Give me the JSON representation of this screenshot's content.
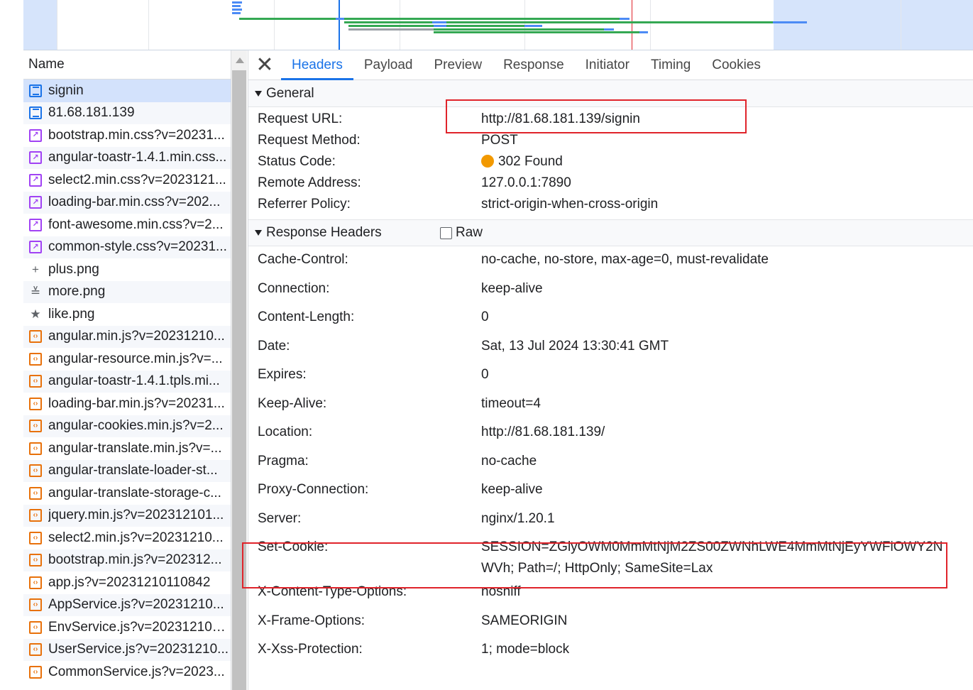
{
  "colors": {
    "accent": "#1a73e8",
    "highlight_box": "#e0242b",
    "status_warning": "#f29900",
    "timeline_green": "#34a853",
    "timeline_blue": "#4c8bf5"
  },
  "request_list": {
    "header": "Name",
    "items": [
      {
        "name": "signin",
        "icon": "document-icon",
        "type": "doc"
      },
      {
        "name": "81.68.181.139",
        "icon": "document-icon",
        "type": "doc"
      },
      {
        "name": "bootstrap.min.css?v=20231...",
        "icon": "stylesheet-icon",
        "type": "css"
      },
      {
        "name": "angular-toastr-1.4.1.min.css...",
        "icon": "stylesheet-icon",
        "type": "css"
      },
      {
        "name": "select2.min.css?v=2023121...",
        "icon": "stylesheet-icon",
        "type": "css"
      },
      {
        "name": "loading-bar.min.css?v=202...",
        "icon": "stylesheet-icon",
        "type": "css"
      },
      {
        "name": "font-awesome.min.css?v=2...",
        "icon": "stylesheet-icon",
        "type": "css"
      },
      {
        "name": "common-style.css?v=20231...",
        "icon": "stylesheet-icon",
        "type": "css"
      },
      {
        "name": "plus.png",
        "icon": "plus-image-icon",
        "type": "img",
        "glyph": "+"
      },
      {
        "name": "more.png",
        "icon": "double-chevron-image-icon",
        "type": "img",
        "glyph": "≚"
      },
      {
        "name": "like.png",
        "icon": "star-image-icon",
        "type": "img",
        "glyph": "★"
      },
      {
        "name": "angular.min.js?v=20231210...",
        "icon": "script-icon",
        "type": "js"
      },
      {
        "name": "angular-resource.min.js?v=...",
        "icon": "script-icon",
        "type": "js"
      },
      {
        "name": "angular-toastr-1.4.1.tpls.mi...",
        "icon": "script-icon",
        "type": "js"
      },
      {
        "name": "loading-bar.min.js?v=20231...",
        "icon": "script-icon",
        "type": "js"
      },
      {
        "name": "angular-cookies.min.js?v=2...",
        "icon": "script-icon",
        "type": "js"
      },
      {
        "name": "angular-translate.min.js?v=...",
        "icon": "script-icon",
        "type": "js"
      },
      {
        "name": "angular-translate-loader-st...",
        "icon": "script-icon",
        "type": "js"
      },
      {
        "name": "angular-translate-storage-c...",
        "icon": "script-icon",
        "type": "js"
      },
      {
        "name": "jquery.min.js?v=202312101...",
        "icon": "script-icon",
        "type": "js"
      },
      {
        "name": "select2.min.js?v=20231210...",
        "icon": "script-icon",
        "type": "js"
      },
      {
        "name": "bootstrap.min.js?v=202312...",
        "icon": "script-icon",
        "type": "js"
      },
      {
        "name": "app.js?v=20231210110842",
        "icon": "script-icon",
        "type": "js"
      },
      {
        "name": "AppService.js?v=20231210...",
        "icon": "script-icon",
        "type": "js"
      },
      {
        "name": "EnvService.js?v=202312101...",
        "icon": "script-icon",
        "type": "js"
      },
      {
        "name": "UserService.js?v=20231210...",
        "icon": "script-icon",
        "type": "js"
      },
      {
        "name": "CommonService.js?v=2023...",
        "icon": "script-icon",
        "type": "js"
      }
    ]
  },
  "tabs": {
    "close_label": "✕",
    "items": [
      "Headers",
      "Payload",
      "Preview",
      "Response",
      "Initiator",
      "Timing",
      "Cookies"
    ],
    "active": "Headers"
  },
  "general": {
    "title": "General",
    "rows": [
      {
        "key": "Request URL:",
        "value": "http://81.68.181.139/signin"
      },
      {
        "key": "Request Method:",
        "value": "POST"
      },
      {
        "key": "Status Code:",
        "value": "302 Found"
      },
      {
        "key": "Remote Address:",
        "value": "127.0.0.1:7890"
      },
      {
        "key": "Referrer Policy:",
        "value": "strict-origin-when-cross-origin"
      }
    ]
  },
  "response_headers": {
    "title": "Response Headers",
    "raw_label": "Raw",
    "raw_checked": false,
    "rows": [
      {
        "key": "Cache-Control:",
        "value": "no-cache, no-store, max-age=0, must-revalidate"
      },
      {
        "key": "Connection:",
        "value": "keep-alive"
      },
      {
        "key": "Content-Length:",
        "value": "0"
      },
      {
        "key": "Date:",
        "value": "Sat, 13 Jul 2024 13:30:41 GMT"
      },
      {
        "key": "Expires:",
        "value": "0"
      },
      {
        "key": "Keep-Alive:",
        "value": "timeout=4"
      },
      {
        "key": "Location:",
        "value": "http://81.68.181.139/"
      },
      {
        "key": "Pragma:",
        "value": "no-cache"
      },
      {
        "key": "Proxy-Connection:",
        "value": "keep-alive"
      },
      {
        "key": "Server:",
        "value": "nginx/1.20.1"
      },
      {
        "key": "Set-Cookie:",
        "value": "SESSION=ZGlyOWM0MmMtNjM2ZS00ZWNhLWE4MmMtNjEyYWFiOWY2NWVh; Path=/; HttpOnly; SameSite=Lax"
      },
      {
        "key": "X-Content-Type-Options:",
        "value": "nosniff"
      },
      {
        "key": "X-Frame-Options:",
        "value": "SAMEORIGIN"
      },
      {
        "key": "X-Xss-Protection:",
        "value": "1; mode=block"
      }
    ]
  }
}
